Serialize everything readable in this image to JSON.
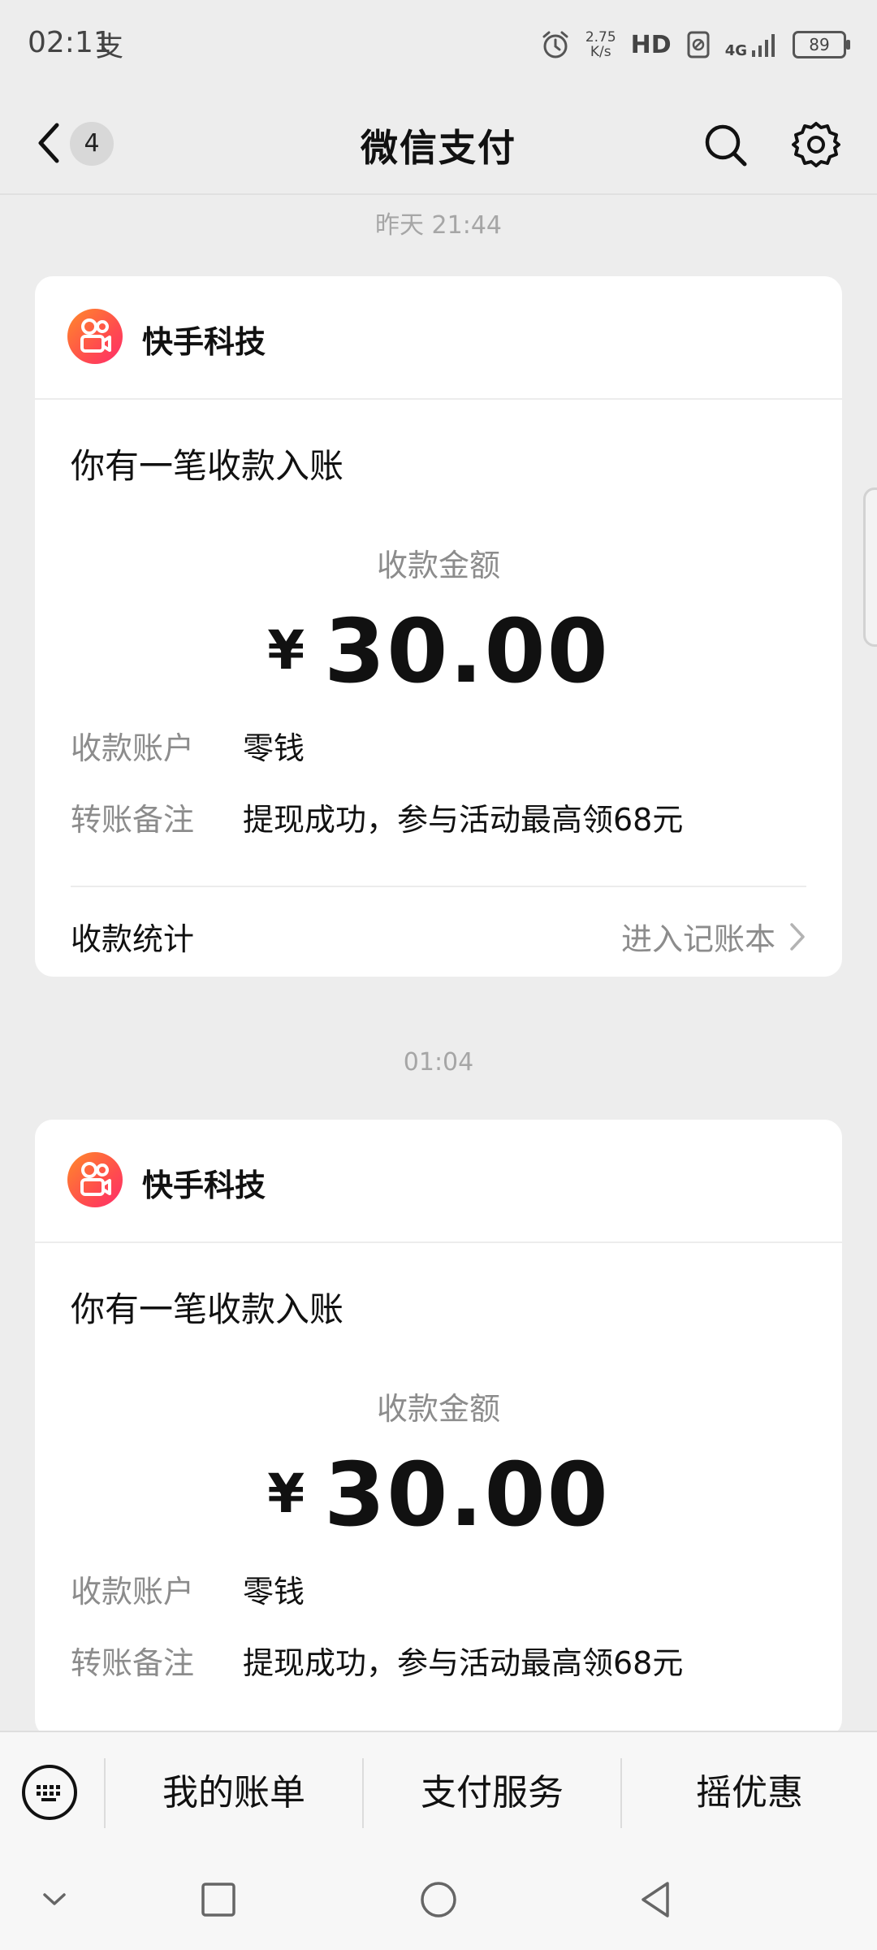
{
  "status_bar": {
    "time": "02:11",
    "pay_icon_glyph": "支",
    "speed_value": "2.75",
    "speed_unit": "K/s",
    "hd": "HD",
    "network": "4G",
    "battery": "89"
  },
  "nav": {
    "unread_count": "4",
    "title": "微信支付"
  },
  "messages": [
    {
      "timestamp": "昨天 21:44",
      "app_name": "快手科技",
      "title": "你有一笔收款入账",
      "amount_label": "收款金额",
      "currency": "¥",
      "amount": "30.00",
      "account_label": "收款账户",
      "account_value": "零钱",
      "note_label": "转账备注",
      "note_value": "提现成功，参与活动最高领68元",
      "stats_label": "收款统计",
      "stats_link": "进入记账本"
    },
    {
      "timestamp": "01:04",
      "app_name": "快手科技",
      "title": "你有一笔收款入账",
      "amount_label": "收款金额",
      "currency": "¥",
      "amount": "30.00",
      "account_label": "收款账户",
      "account_value": "零钱",
      "note_label": "转账备注",
      "note_value": "提现成功，参与活动最高领68元"
    }
  ],
  "menu": {
    "items": [
      "我的账单",
      "支付服务",
      "摇优惠"
    ]
  },
  "colors": {
    "background": "#ededed",
    "card": "#ffffff",
    "secondary_text": "#8c8c8c",
    "logo_gradient_start": "#ff8a2a",
    "logo_gradient_end": "#ff2d6b"
  },
  "icons": {
    "back": "chevron-left-icon",
    "search": "search-icon",
    "settings": "gear-icon",
    "app_logo": "kuaishou-logo-icon",
    "chevron": "chevron-right-icon",
    "keyboard": "keyboard-icon",
    "sys_collapse": "chevron-down-icon",
    "sys_recent": "square-icon",
    "sys_home": "circle-icon",
    "sys_back": "triangle-back-icon"
  }
}
